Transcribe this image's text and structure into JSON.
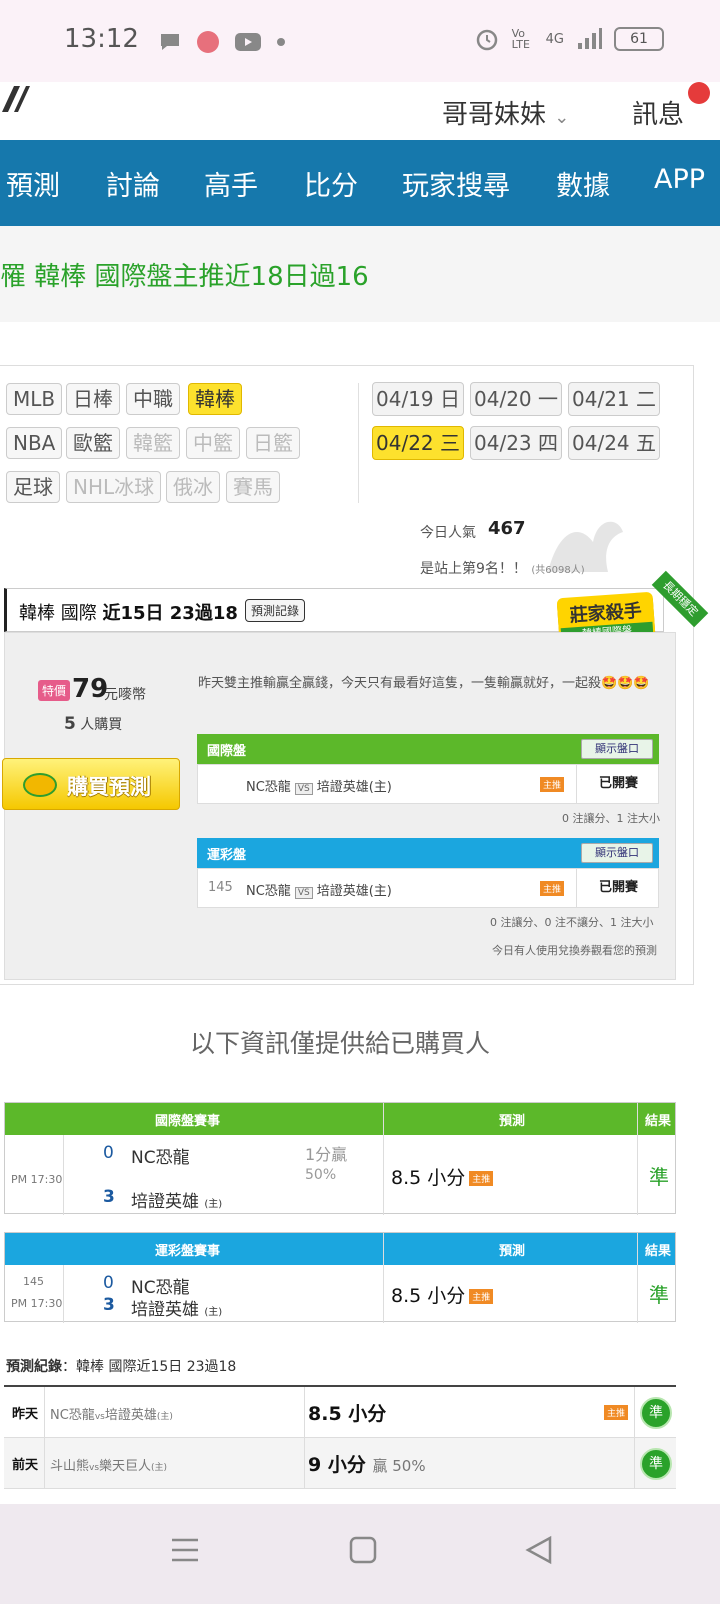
{
  "status_bar": {
    "time": "13:12",
    "network": "4G",
    "volte": "Vo LTE",
    "battery": "61"
  },
  "header": {
    "user": "哥哥妹妹",
    "messages": "訊息"
  },
  "nav": [
    "預測",
    "討論",
    "高手",
    "比分",
    "玩家搜尋",
    "數據",
    "APP"
  ],
  "headline": "罹 韓棒 國際盤主推近18日過16",
  "filters": {
    "row1": [
      {
        "label": "MLB",
        "state": "normal"
      },
      {
        "label": "日棒",
        "state": "normal"
      },
      {
        "label": "中職",
        "state": "normal"
      },
      {
        "label": "韓棒",
        "state": "active"
      }
    ],
    "row2": [
      {
        "label": "NBA",
        "state": "normal"
      },
      {
        "label": "歐籃",
        "state": "normal"
      },
      {
        "label": "韓籃",
        "state": "dim"
      },
      {
        "label": "中籃",
        "state": "dim"
      },
      {
        "label": "日籃",
        "state": "dim"
      }
    ],
    "row3": [
      {
        "label": "足球",
        "state": "normal"
      },
      {
        "label": "NHL冰球",
        "state": "dim"
      },
      {
        "label": "俄冰",
        "state": "dim"
      },
      {
        "label": "賽馬",
        "state": "dim"
      }
    ]
  },
  "dates": [
    {
      "label": "04/19 日",
      "active": false
    },
    {
      "label": "04/20 一",
      "active": false
    },
    {
      "label": "04/21 二",
      "active": false
    },
    {
      "label": "04/22 三",
      "active": true
    },
    {
      "label": "04/23 四",
      "active": false
    },
    {
      "label": "04/24 五",
      "active": false
    }
  ],
  "popularity": {
    "label": "今日人氣",
    "value": "467",
    "rank_text": "是站上第9名！！",
    "total": "(共6098人)"
  },
  "prediction": {
    "title_prefix": "韓棒 國際 ",
    "title_bold": "近15日 23過18",
    "record_button": "預測記錄",
    "badge_main": "莊家殺手",
    "badge_sub": "韓棒國際盤",
    "badge_ribbon": "長期穩定",
    "special_label": "特價",
    "price": "79",
    "price_unit": "元嘜幣",
    "buyers_count": "5",
    "buyers_label": "人購買",
    "buy_button": "購買預測",
    "comment": "昨天雙主推輸贏全贏錢，今天只有最看好這隻，一隻輸贏就好，一起殺🤩🤩🤩",
    "market1": {
      "label": "國際盤",
      "show_button": "顯示盤口",
      "num": "",
      "team_a": "NC恐龍",
      "vs": "VS",
      "team_b": "培證英雄(主)",
      "tag": "主推",
      "status": "已開賽",
      "note": "0 注讓分、1 注大小"
    },
    "market2": {
      "label": "運彩盤",
      "show_button": "顯示盤口",
      "num": "145",
      "team_a": "NC恐龍",
      "vs": "VS",
      "team_b": "培證英雄(主)",
      "tag": "主推",
      "status": "已開賽",
      "note": "0 注讓分、0 注不讓分、1 注大小"
    },
    "voucher_note": "今日有人使用兌換券觀看您的預測"
  },
  "info_only": "以下資訊僅提供給已購買人",
  "table1": {
    "headers": [
      "國際盤賽事",
      "預測",
      "結果"
    ],
    "time": "PM 17:30",
    "score_a": "0",
    "team_a": "NC恐龍",
    "score_b": "3",
    "team_b": "培證英雄",
    "home": "(主)",
    "handicap_line1": "1分贏",
    "handicap_line2": "50%",
    "prediction": "8.5 小分",
    "tag": "主推",
    "result": "準"
  },
  "table2": {
    "headers": [
      "運彩盤賽事",
      "預測",
      "結果"
    ],
    "num": "145",
    "time": "PM 17:30",
    "score_a": "0",
    "team_a": "NC恐龍",
    "score_b": "3",
    "team_b": "培證英雄",
    "home": "(主)",
    "prediction": "8.5 小分",
    "tag": "主推",
    "result": "準"
  },
  "record": {
    "title_bold": "預測紀錄",
    "title_rest": "：韓棒 國際近15日 23過18",
    "rows": [
      {
        "day": "昨天",
        "game": "NC恐龍",
        "vs": "vs",
        "game_b": "培證英雄",
        "home": "(主)",
        "pred": "8.5 小分",
        "extra": "",
        "tag": "主推",
        "result": "準"
      },
      {
        "day": "前天",
        "game": "斗山熊",
        "vs": "vs",
        "game_b": "樂天巨人",
        "home": "(主)",
        "pred": "9 小分",
        "extra": "贏 50%",
        "tag": "",
        "result": "準"
      }
    ]
  },
  "colors": {
    "nav_bg": "#1678ac",
    "green": "#2aa22a",
    "blue_header": "#1ba6df",
    "green_header": "#5cb82a",
    "yellow": "#fde12d"
  }
}
